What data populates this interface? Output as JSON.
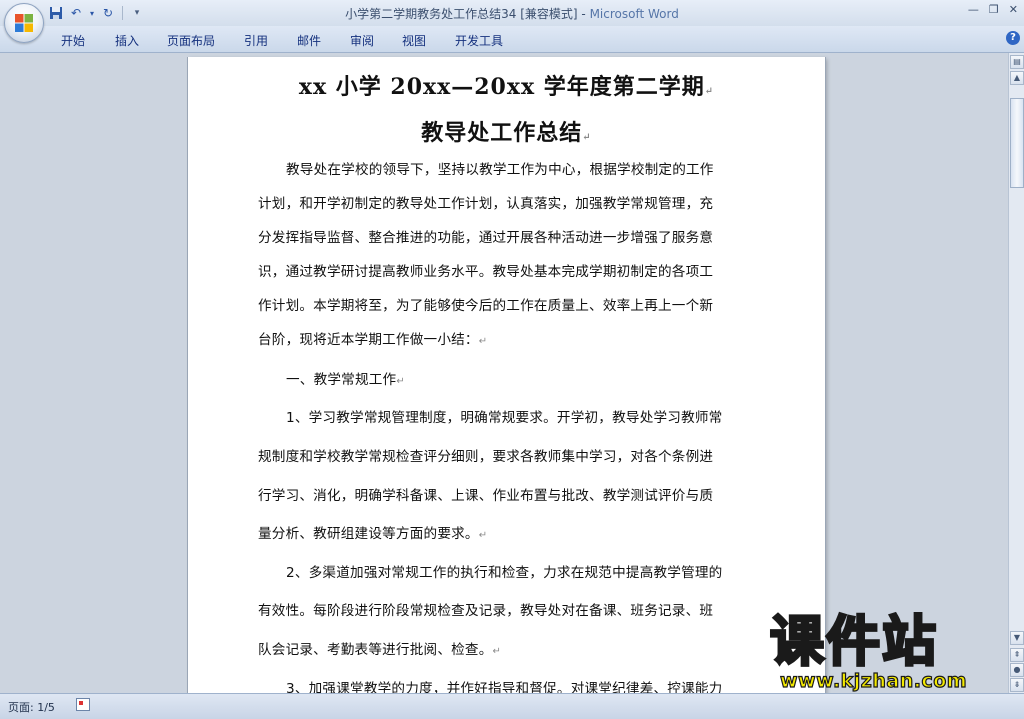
{
  "window": {
    "title": "小学第二学期教务处工作总结34 [兼容模式]",
    "app_name": "Microsoft Word",
    "separator": " - "
  },
  "ribbon": {
    "tabs": [
      "开始",
      "插入",
      "页面布局",
      "引用",
      "邮件",
      "审阅",
      "视图",
      "开发工具"
    ]
  },
  "document": {
    "heading_1": "xx 小学 20xx—20xx 学年度第二学期",
    "heading_2": "教导处工作总结",
    "lines": [
      "教导处在学校的领导下，坚持以教学工作为中心，根据学校制定的工作",
      "计划，和开学初制定的教导处工作计划，认真落实，加强教学常规管理，充",
      "分发挥指导监督、整合推进的功能，通过开展各种活动进一步增强了服务意",
      "识，通过教学研讨提高教师业务水平。教导处基本完成学期初制定的各项工",
      "作计划。本学期将至，为了能够使今后的工作在质量上、效率上再上一个新",
      "台阶，现将近本学期工作做一小结：",
      "一、教学常规工作",
      "1、学习教学常规管理制度，明确常规要求。开学初，教导处学习教师常",
      "规制度和学校教学常规检查评分细则，要求各教师集中学习，对各个条例进",
      "行学习、消化，明确学科备课、上课、作业布置与批改、教学测试评价与质",
      "量分析、教研组建设等方面的要求。",
      "2、多渠道加强对常规工作的执行和检查，力求在规范中提高教学管理的",
      "有效性。每阶段进行阶段常规检查及记录，教导处对在备课、班务记录、班",
      "队会记录、考勤表等进行批阅、检查。",
      "3、加强课堂教学的力度，并作好指导和督促。对课堂纪律差、控课能力"
    ],
    "paragraph_mark": "↵"
  },
  "statusbar": {
    "page_info": "页面: 1/5"
  },
  "watermark": {
    "title": "课件站",
    "url": "www.kjzhan.com"
  }
}
